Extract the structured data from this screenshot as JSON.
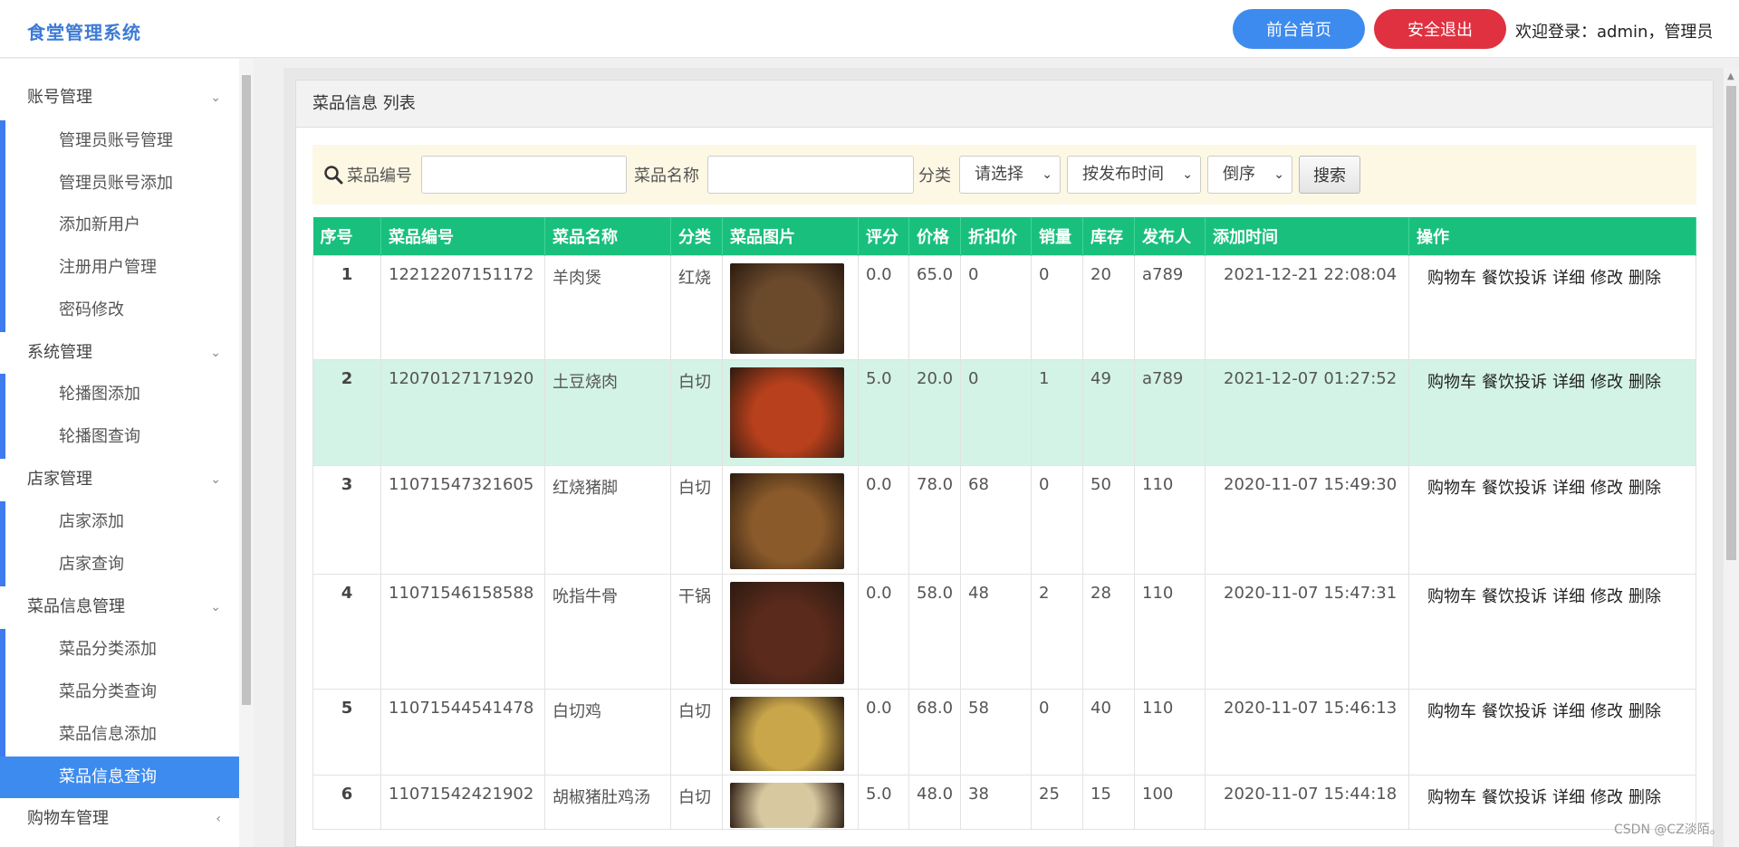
{
  "header": {
    "logo": "食堂管理系统",
    "home_btn": "前台首页",
    "logout_btn": "安全退出",
    "welcome": "欢迎登录：admin，管理员"
  },
  "sidebar": {
    "groups": [
      {
        "title": "账号管理",
        "items": [
          "管理员账号管理",
          "管理员账号添加",
          "添加新用户",
          "注册用户管理",
          "密码修改"
        ]
      },
      {
        "title": "系统管理",
        "items": [
          "轮播图添加",
          "轮播图查询"
        ]
      },
      {
        "title": "店家管理",
        "items": [
          "店家添加",
          "店家查询"
        ]
      },
      {
        "title": "菜品信息管理",
        "items": [
          "菜品分类添加",
          "菜品分类查询",
          "菜品信息添加",
          "菜品信息查询"
        ]
      },
      {
        "title": "购物车管理",
        "items": []
      }
    ],
    "active_item": "菜品信息查询"
  },
  "panel": {
    "title": "菜品信息 列表"
  },
  "search": {
    "code_label": "菜品编号",
    "code_value": "",
    "name_label": "菜品名称",
    "name_value": "",
    "category_label": "分类",
    "category_select": "请选择",
    "sort_select": "按发布时间",
    "order_select": "倒序",
    "search_btn": "搜索"
  },
  "table": {
    "headers": [
      "序号",
      "菜品编号",
      "菜品名称",
      "分类",
      "菜品图片",
      "评分",
      "价格",
      "折扣价",
      "销量",
      "库存",
      "发布人",
      "添加时间",
      "操作"
    ],
    "ops": [
      "购物车",
      "餐饮投诉",
      "详细",
      "修改",
      "删除"
    ],
    "rows": [
      {
        "no": "1",
        "code": "12212207151172",
        "name": "羊肉煲",
        "cat": "红烧",
        "score": "0.0",
        "price": "65.0",
        "discount": "0",
        "sales": "0",
        "stock": "20",
        "publisher": "a789",
        "time": "2021-12-21 22:08:04",
        "img_color": "#6b4a2c"
      },
      {
        "no": "2",
        "code": "12070127171920",
        "name": "土豆烧肉",
        "cat": "白切",
        "score": "5.0",
        "price": "20.0",
        "discount": "0",
        "sales": "1",
        "stock": "49",
        "publisher": "a789",
        "time": "2021-12-07 01:27:52",
        "img_color": "#b8401c"
      },
      {
        "no": "3",
        "code": "11071547321605",
        "name": "红烧猪脚",
        "cat": "白切",
        "score": "0.0",
        "price": "78.0",
        "discount": "68",
        "sales": "0",
        "stock": "50",
        "publisher": "110",
        "time": "2020-11-07 15:49:30",
        "img_color": "#8a5a2a"
      },
      {
        "no": "4",
        "code": "11071546158588",
        "name": "吮指牛骨",
        "cat": "干锅",
        "score": "0.0",
        "price": "58.0",
        "discount": "48",
        "sales": "2",
        "stock": "28",
        "publisher": "110",
        "time": "2020-11-07 15:47:31",
        "img_color": "#5a2a1c"
      },
      {
        "no": "5",
        "code": "11071544541478",
        "name": "白切鸡",
        "cat": "白切",
        "score": "0.0",
        "price": "68.0",
        "discount": "58",
        "sales": "0",
        "stock": "40",
        "publisher": "110",
        "time": "2020-11-07 15:46:13",
        "img_color": "#c9a64a"
      },
      {
        "no": "6",
        "code": "11071542421902",
        "name": "胡椒猪肚鸡汤",
        "cat": "白切",
        "score": "5.0",
        "price": "48.0",
        "discount": "38",
        "sales": "25",
        "stock": "15",
        "publisher": "100",
        "time": "2020-11-07 15:44:18",
        "img_color": "#d8c8a0"
      }
    ]
  },
  "watermark": "CSDN @CZ淡陌。"
}
